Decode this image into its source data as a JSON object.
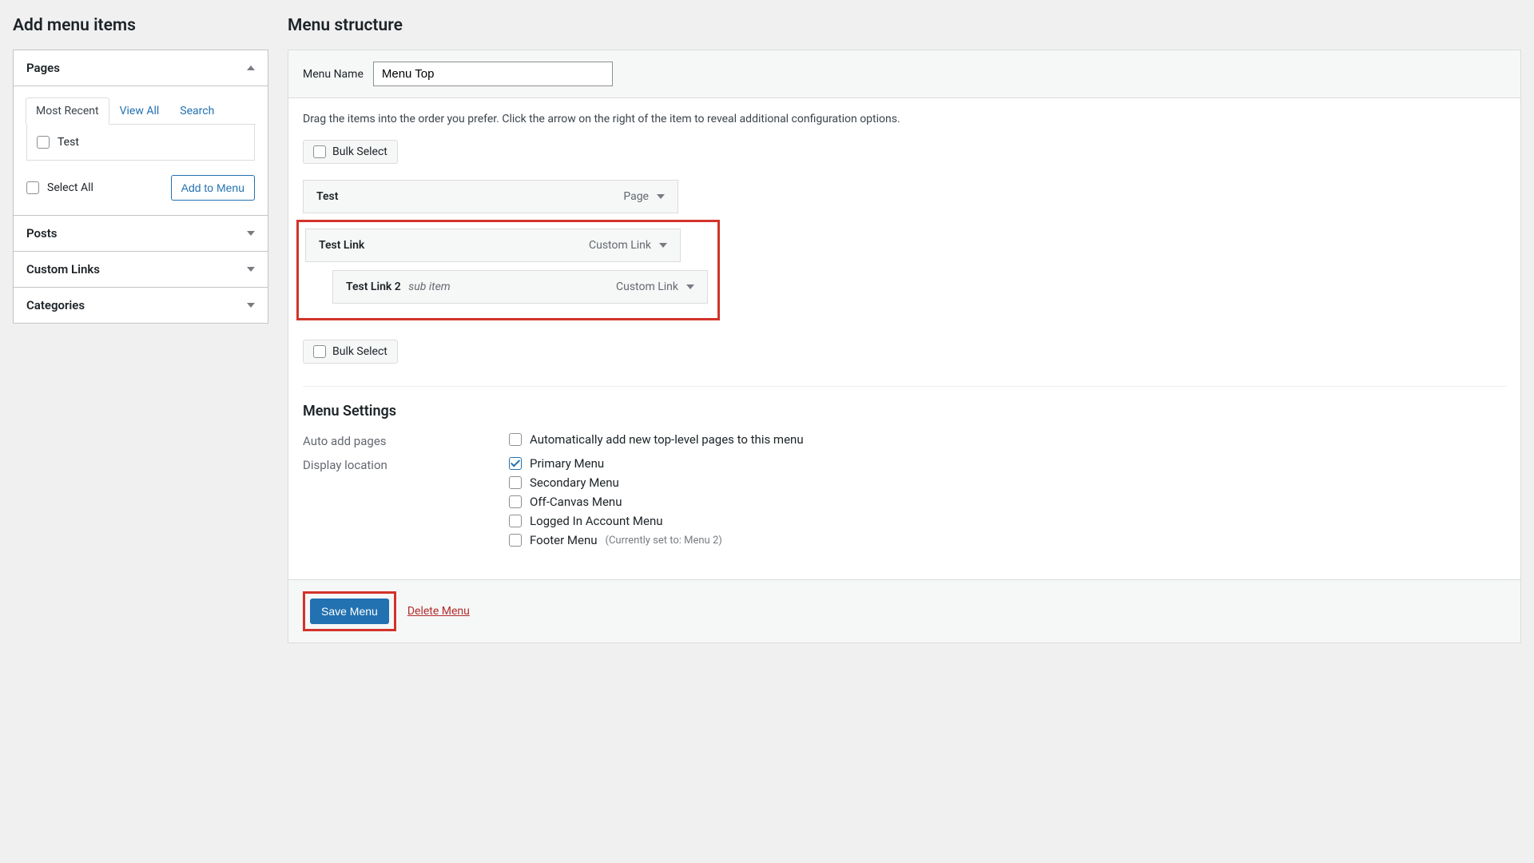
{
  "left": {
    "title": "Add menu items",
    "panels": {
      "pages": {
        "label": "Pages",
        "tabs": {
          "recent": "Most Recent",
          "view_all": "View All",
          "search": "Search"
        },
        "items": [
          {
            "label": "Test"
          }
        ],
        "select_all": "Select All",
        "add_btn": "Add to Menu"
      },
      "posts": {
        "label": "Posts"
      },
      "custom_links": {
        "label": "Custom Links"
      },
      "categories": {
        "label": "Categories"
      }
    }
  },
  "right": {
    "title": "Menu structure",
    "menu_name_label": "Menu Name",
    "menu_name_value": "Menu Top",
    "instructions": "Drag the items into the order you prefer. Click the arrow on the right of the item to reveal additional configuration options.",
    "bulk_select": "Bulk Select",
    "items": [
      {
        "label": "Test",
        "type": "Page",
        "indent": 0
      },
      {
        "label": "Test Link",
        "type": "Custom Link",
        "indent": 0
      },
      {
        "label": "Test Link 2",
        "type": "Custom Link",
        "indent": 1,
        "subnote": "sub item"
      }
    ],
    "settings": {
      "heading": "Menu Settings",
      "auto_label": "Auto add pages",
      "auto_option": "Automatically add new top-level pages to this menu",
      "display_label": "Display location",
      "locations": [
        {
          "label": "Primary Menu",
          "checked": true
        },
        {
          "label": "Secondary Menu",
          "checked": false
        },
        {
          "label": "Off-Canvas Menu",
          "checked": false
        },
        {
          "label": "Logged In Account Menu",
          "checked": false
        },
        {
          "label": "Footer Menu",
          "checked": false,
          "note": "(Currently set to: Menu 2)"
        }
      ]
    },
    "save_btn": "Save Menu",
    "delete_link": "Delete Menu"
  }
}
